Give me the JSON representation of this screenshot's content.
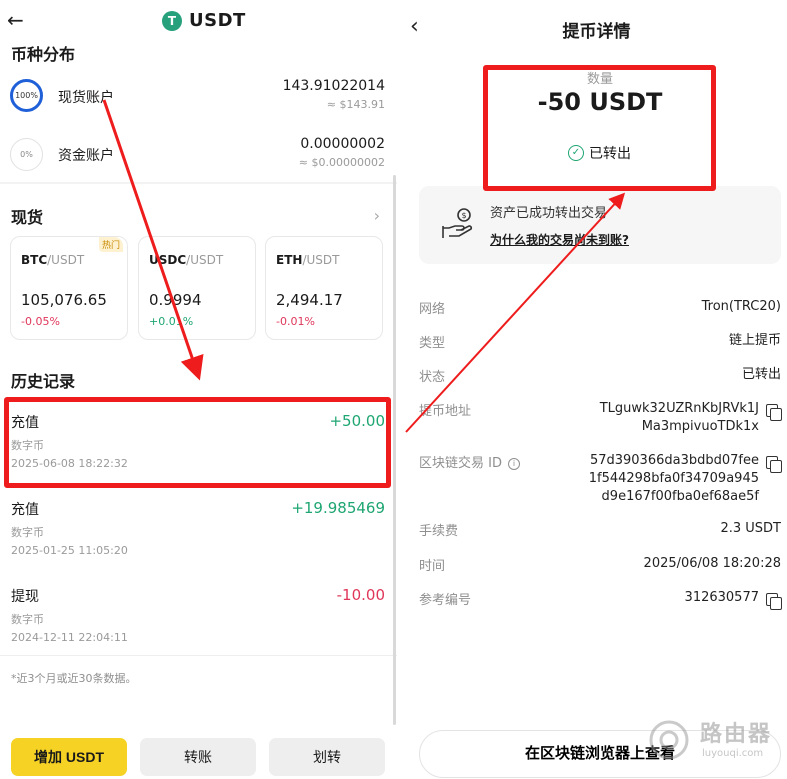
{
  "left": {
    "back_glyph": "←",
    "coin_logo_letter": "T",
    "coin_title": "USDT",
    "dist_title": "币种分布",
    "accounts": [
      {
        "ring": "100%",
        "name": "现货账户",
        "value": "143.91022014",
        "fiat": "≈ $143.91"
      },
      {
        "ring": "0%",
        "name": "资金账户",
        "value": "0.00000002",
        "fiat": "≈ $0.00000002"
      }
    ],
    "spot_title": "现货",
    "chevron": "›",
    "tickers": [
      {
        "base": "BTC",
        "quote": "/USDT",
        "price": "105,076.65",
        "change": "-0.05%",
        "hot": "热门"
      },
      {
        "base": "USDC",
        "quote": "/USDT",
        "price": "0.9994",
        "change": "+0.01%"
      },
      {
        "base": "ETH",
        "quote": "/USDT",
        "price": "2,494.17",
        "change": "-0.01%"
      }
    ],
    "history_title": "历史记录",
    "records": [
      {
        "type": "充值",
        "amount": "+50.00",
        "sub": "数字币",
        "time": "2025-06-08 18:22:32"
      },
      {
        "type": "充值",
        "amount": "+19.985469",
        "sub": "数字币",
        "time": "2025-01-25 11:05:20"
      },
      {
        "type": "提现",
        "amount": "-10.00",
        "sub": "数字币",
        "time": "2024-12-11 22:04:11"
      }
    ],
    "note": "*近3个月或近30条数据。",
    "buttons": {
      "add": "增加 USDT",
      "transfer": "转账",
      "move": "划转"
    }
  },
  "right": {
    "back_glyph": "‹",
    "title": "提币详情",
    "qty_label": "数量",
    "qty_value": "-50 USDT",
    "status_icon": "✓",
    "status": "已转出",
    "info_title": "资产已成功转出交易",
    "info_link": "为什么我的交易尚未到账?",
    "rows": [
      {
        "key": "网络",
        "value": "Tron(TRC20)"
      },
      {
        "key": "类型",
        "value": "链上提币"
      },
      {
        "key": "状态",
        "value": "已转出"
      },
      {
        "key": "提币地址",
        "value_lines": [
          "TLguwk32UZRnKbJRVk1J",
          "Ma3mpivuoTDk1x"
        ]
      },
      {
        "key": "区块链交易 ID",
        "value_lines": [
          "57d390366da3bdbd07fee",
          "1f544298bfa0f34709a945",
          "d9e167f00fba0ef68ae5f"
        ]
      },
      {
        "key": "手续费",
        "value": "2.3 USDT"
      },
      {
        "key": "时间",
        "value": "2025/06/08 18:20:28"
      },
      {
        "key": "参考编号",
        "value": "312630577"
      }
    ],
    "info_i": "i",
    "explorer_button": "在区块链浏览器上查看"
  },
  "watermark": {
    "text": "路由器",
    "sub": "luyouqi.com"
  },
  "colors": {
    "accent_yellow": "#f5d223",
    "positive": "#1ea672",
    "negative": "#e0365a",
    "annotation_red": "#ee1c1c",
    "tether_green": "#26a17b"
  }
}
